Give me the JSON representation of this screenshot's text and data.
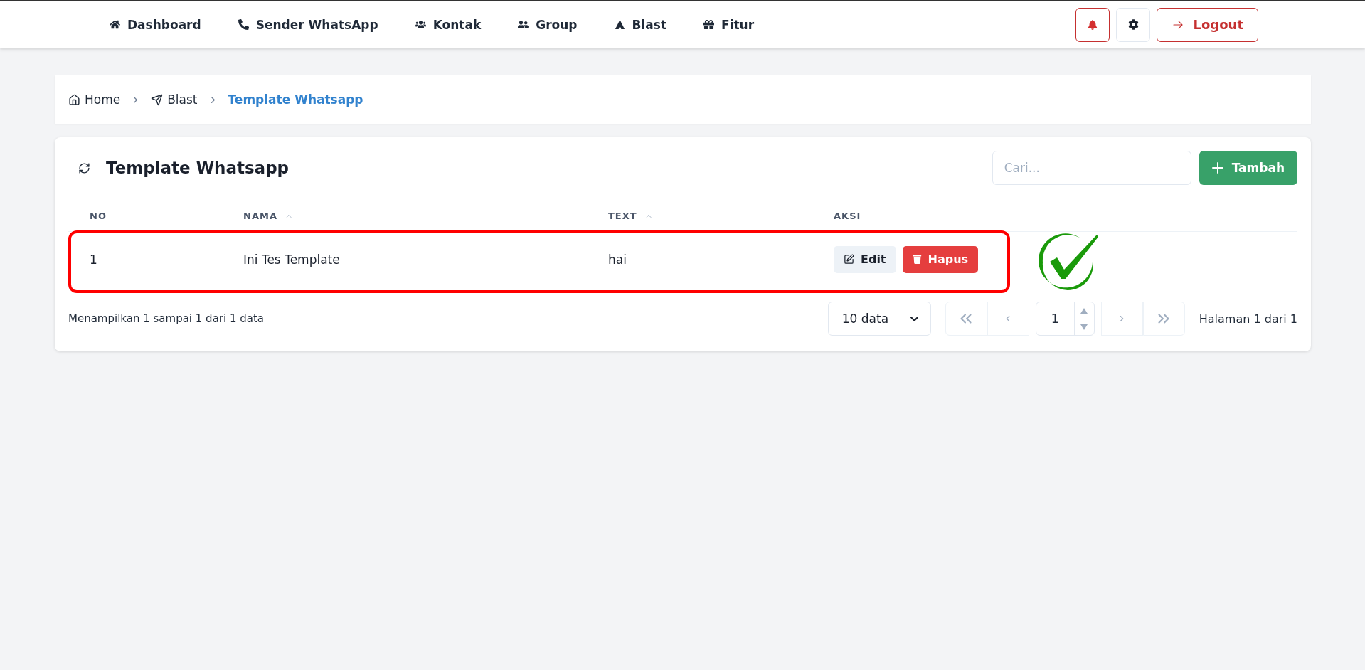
{
  "navbar": {
    "items": [
      {
        "label": "Dashboard"
      },
      {
        "label": "Sender WhatsApp"
      },
      {
        "label": "Kontak"
      },
      {
        "label": "Group"
      },
      {
        "label": "Blast"
      },
      {
        "label": "Fitur"
      }
    ],
    "logout": "Logout"
  },
  "breadcrumb": [
    {
      "label": "Home",
      "selected": false
    },
    {
      "label": "Blast",
      "selected": false
    },
    {
      "label": "Template Whatsapp",
      "selected": true
    }
  ],
  "card": {
    "title": "Template Whatsapp",
    "search": {
      "placeholder": "Cari..."
    },
    "add_button": "Tambah",
    "table": {
      "columns": [
        {
          "label": "NO",
          "sortable": false
        },
        {
          "label": "NAMA",
          "sortable": true
        },
        {
          "label": "TEXT",
          "sortable": true
        },
        {
          "label": "AKSI",
          "sortable": false
        }
      ],
      "rows": [
        {
          "no": "1",
          "nama": "Ini Tes Template",
          "text": "hai",
          "highlighted": true,
          "actions": [
            "Edit",
            "Hapus"
          ]
        }
      ]
    },
    "summary": "Menampilkan 1 sampai 1 dari 1 data",
    "page_size": "10 data",
    "page": "1",
    "page_info": "Halaman 1 dari 1"
  }
}
